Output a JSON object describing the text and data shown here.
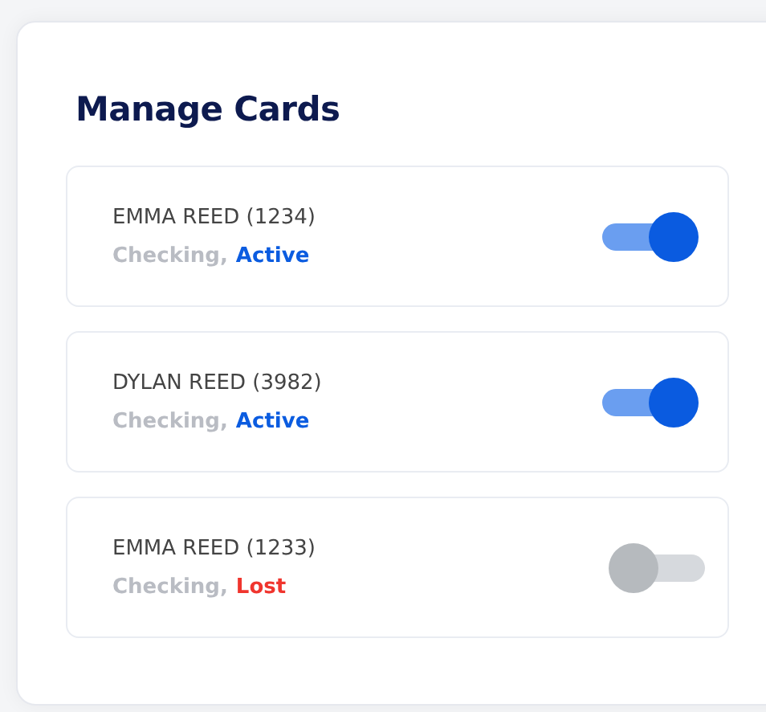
{
  "title": "Manage Cards",
  "cards": [
    {
      "name": "EMMA REED (1234)",
      "account_type": "Checking,",
      "status": "Active",
      "color": "#0b5ce0",
      "on": true
    },
    {
      "name": "DYLAN REED (3982)",
      "account_type": "Checking,",
      "status": "Active",
      "color": "#0b5ce0",
      "on": true
    },
    {
      "name": "EMMA REED (1233)",
      "account_type": "Checking,",
      "status": "Lost",
      "color": "#f0352e",
      "on": false
    }
  ]
}
